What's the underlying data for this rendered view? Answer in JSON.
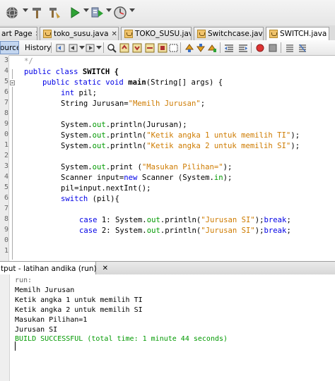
{
  "toolbar": {
    "buttons": [
      "globe-icon",
      "hammer-icon",
      "clean-build-icon",
      "run-icon",
      "debug-icon",
      "profile-icon"
    ]
  },
  "tabs": [
    {
      "label": "art Page",
      "active": false
    },
    {
      "label": "toko_susu.java",
      "active": false
    },
    {
      "label": "TOKO_SUSU.java",
      "active": false
    },
    {
      "label": "Switchcase.java",
      "active": false
    },
    {
      "label": "SWITCH.java",
      "active": true
    }
  ],
  "editor_toolbar": {
    "source_label": "ource",
    "history_label": "History"
  },
  "gutter_numbers": [
    "3",
    "4",
    "5",
    "6",
    "7",
    "8",
    "9",
    "0",
    "1",
    "2",
    "3",
    "4",
    "5",
    "6",
    "7",
    "8",
    "9",
    "0",
    "1"
  ],
  "code": {
    "l1": "*/",
    "l2a": "public class",
    "l2b": " SWITCH {",
    "l3a": "public static void",
    "l3b": " main",
    "l3c": "(String[] args) {",
    "l4a": "int",
    "l4b": " pil;",
    "l5a": "String Jurusan=",
    "l5b": "\"Memilh Jurusan\"",
    "l5c": ";",
    "l7a": "System.",
    "l7b": "out",
    "l7c": ".println(Jurusan);",
    "l8a": "System.",
    "l8b": "out",
    "l8c": ".println(",
    "l8d": "\"Ketik angka 1 untuk memilih TI\"",
    "l8e": ");",
    "l9a": "System.",
    "l9b": "out",
    "l9c": ".println(",
    "l9d": "\"Ketik angka 2 untuk memilih SI\"",
    "l9e": ");",
    "l11a": "System.",
    "l11b": "out",
    "l11c": ".print (",
    "l11d": "\"Masukan Pilihan=\"",
    "l11e": ");",
    "l12a": "Scanner input=",
    "l12b": "new",
    "l12c": " Scanner (System.",
    "l12d": "in",
    "l12e": ");",
    "l13": "pil=input.nextInt();",
    "l14a": "switch",
    "l14b": " (pil){",
    "l16a": "case",
    "l16b": " 1: System.",
    "l16c": "out",
    "l16d": ".println(",
    "l16e": "\"Jurusan SI\"",
    "l16f": ");",
    "l16g": "break",
    "l16h": ";",
    "l17a": "case",
    "l17b": " 2: System.",
    "l17c": "out",
    "l17d": ".println(",
    "l17e": "\"Jurusan SI\"",
    "l17f": ");",
    "l17g": "break",
    "l17h": ";"
  },
  "output": {
    "tab_label": "tput - latihan andika (run)",
    "lines": [
      "run:",
      "Memilh Jurusan",
      "Ketik angka 1 untuk memilih TI",
      "Ketik angka 2 untuk memilih SI",
      "Masukan Pilihan=1",
      "Jurusan SI",
      "BUILD SUCCESSFUL (total time: 1 minute 44 seconds)"
    ]
  },
  "colors": {
    "keyword": "#0000e6",
    "string": "#ce7b00",
    "field": "#009900",
    "success": "#009900"
  }
}
